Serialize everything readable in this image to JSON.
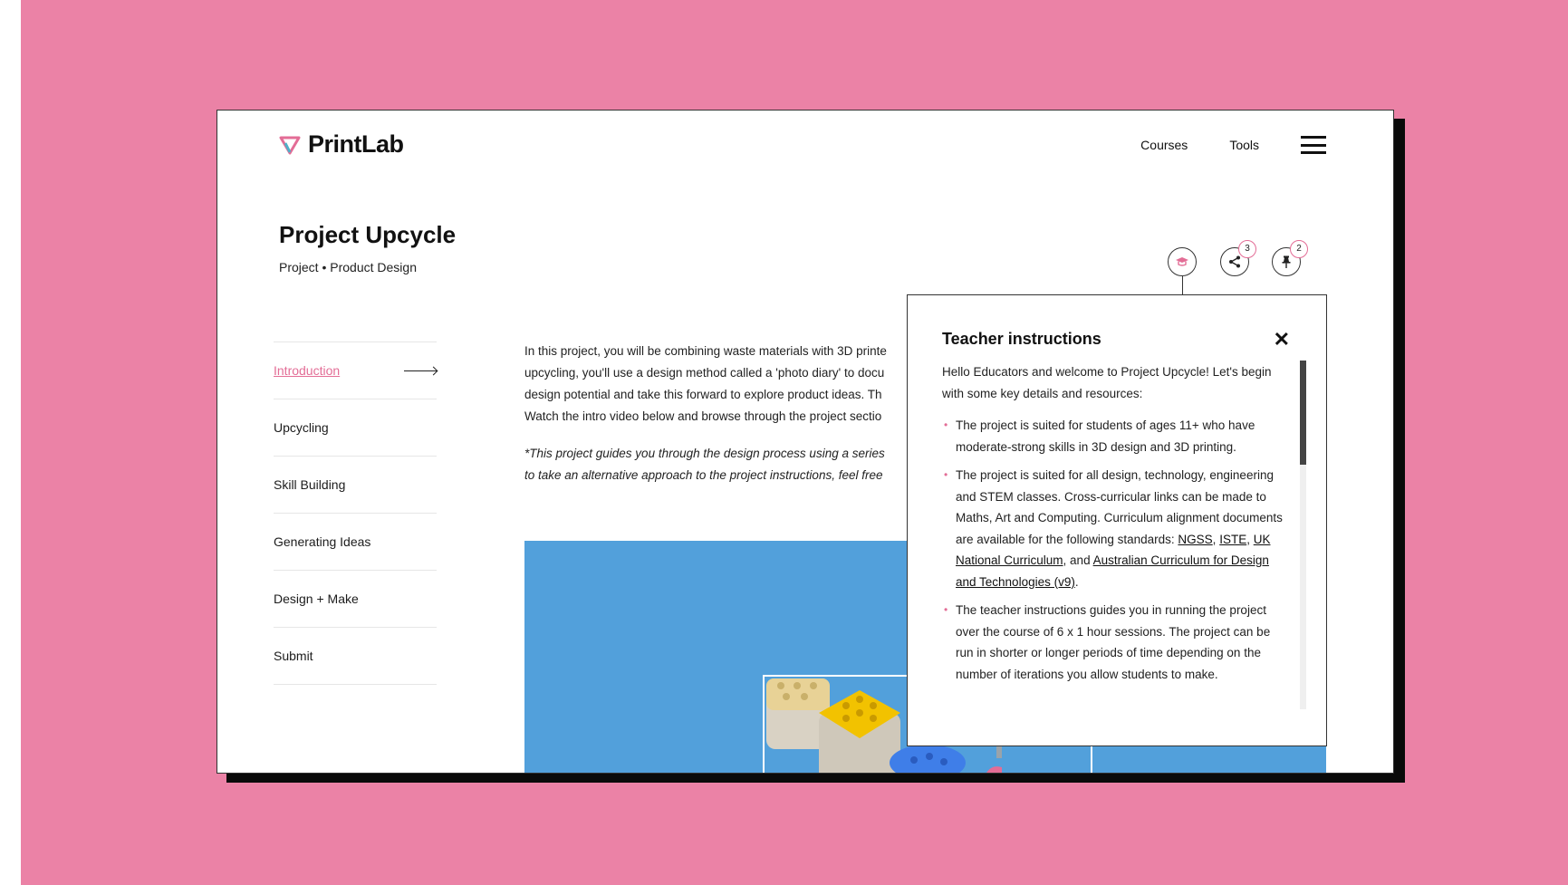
{
  "brand": {
    "name": "PrintLab",
    "accent": "#e36d96",
    "background": "#eb82a6"
  },
  "nav": {
    "courses": "Courses",
    "tools": "Tools",
    "menu_icon": "hamburger-menu-icon"
  },
  "page": {
    "title": "Project Upcycle",
    "category": "Project",
    "subcategory": "Product Design"
  },
  "sidebar": {
    "items": [
      {
        "label": "Introduction",
        "active": true
      },
      {
        "label": "Upcycling"
      },
      {
        "label": "Skill Building"
      },
      {
        "label": "Generating Ideas"
      },
      {
        "label": "Design + Make"
      },
      {
        "label": "Submit"
      }
    ]
  },
  "intro": {
    "lines": [
      "In this project, you will be combining waste materials with 3D printe",
      "upcycling, you'll use a design method called a 'photo diary' to docu",
      "design potential and take this forward to explore product ideas. Th",
      "Watch the intro video below and browse through the project sectio"
    ],
    "note_lines": [
      "*This project guides you through the design process using a series",
      "to take an alternative approach to the project instructions, feel free"
    ]
  },
  "actions": {
    "teacher_icon": "graduation-cap-icon",
    "share_icon": "share-icon",
    "share_count": "3",
    "pin_icon": "pin-icon",
    "pin_count": "2"
  },
  "panel": {
    "title": "Teacher instructions",
    "close": "✕",
    "intro": "Hello Educators and welcome to Project Upcycle! Let's begin with some key details and resources:",
    "bullet1": "The project is suited for students of ages 11+ who have moderate-strong skills in 3D design and 3D printing.",
    "bullet2_prefix": "The project is suited for all design, technology, engineering and STEM classes. Cross-curricular links can be made to Maths, Art and Computing. Curriculum alignment documents are available for the following standards: ",
    "link_ngss": "NGSS",
    "link_iste": "ISTE",
    "link_uk": "UK National Curriculum",
    "and_text": ", and",
    "link_aus": "Australian Curriculum for Design and Technologies (v9)",
    "bullet3": "The teacher instructions guides you in running the project over the course of 6 x 1 hour sessions. The project can be run in shorter or longer periods of time depending on the number of iterations you allow students to make."
  }
}
